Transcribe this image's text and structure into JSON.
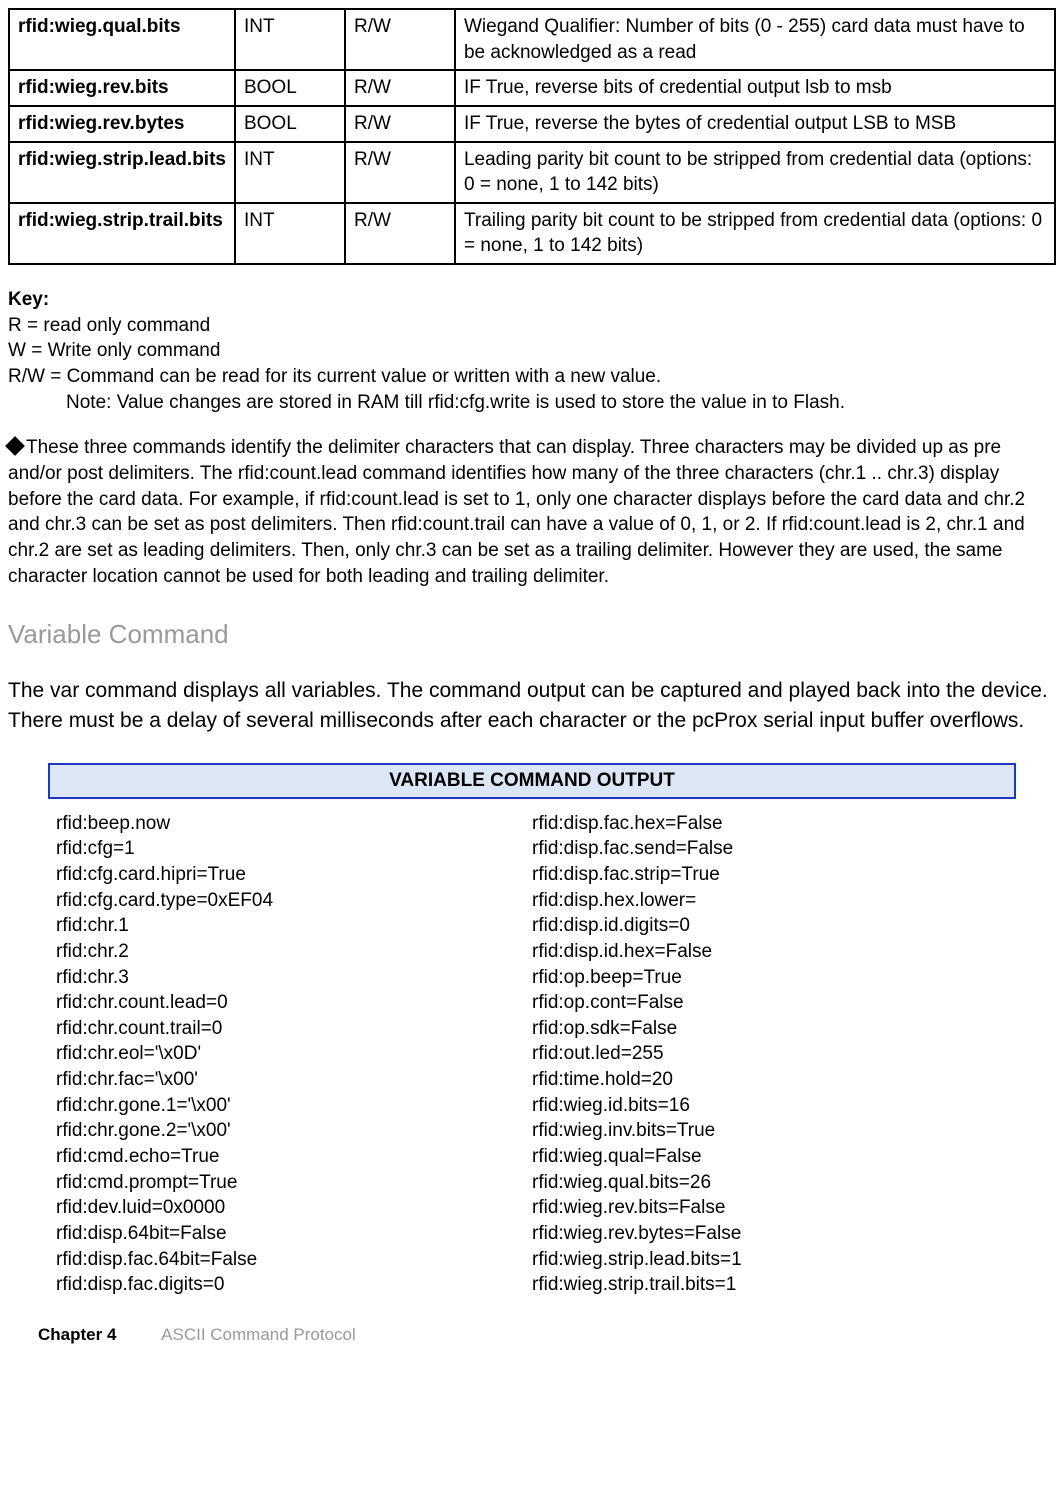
{
  "table": {
    "rows": [
      {
        "name": "rfid:wieg.qual.bits",
        "type": "INT",
        "access": "R/W",
        "desc": "Wiegand Qualifier: Number of bits (0 - 255) card data must have to be acknowledged as a read"
      },
      {
        "name": "rfid:wieg.rev.bits",
        "type": "BOOL",
        "access": "R/W",
        "desc": "IF True, reverse bits of credential output lsb to msb"
      },
      {
        "name": "rfid:wieg.rev.bytes",
        "type": "BOOL",
        "access": "R/W",
        "desc": "IF True, reverse the bytes of credential output LSB to MSB"
      },
      {
        "name": "rfid:wieg.strip.lead.bits",
        "type": "INT",
        "access": "R/W",
        "desc": "Leading parity bit count to be stripped from credential data (options: 0 = none, 1 to 142 bits)"
      },
      {
        "name": "rfid:wieg.strip.trail.bits",
        "type": "INT",
        "access": "R/W",
        "desc": "Trailing parity bit count to be stripped from credential data (options: 0 = none, 1 to 142 bits)"
      }
    ]
  },
  "key": {
    "heading": "Key:",
    "lines": [
      "R = read only command",
      "W = Write only command",
      "R/W = Command can be read for its current value or written with a new value."
    ],
    "note": "Note: Value changes are stored in RAM till rfid:cfg.write is used to store the value in to Flash."
  },
  "delim_para": "These three commands identify the delimiter characters that can display. Three characters may be divided up as pre and/or post delimiters. The rfid:count.lead command identifies how many of the three characters (chr.1 .. chr.3) display before the card data. For example, if rfid:count.lead is set to 1, only one character displays before the card data and chr.2 and chr.3 can be set as post delimiters. Then rfid:count.trail can have a value of 0, 1, or 2. If rfid:count.lead is 2, chr.1 and chr.2 are set as leading delimiters. Then, only chr.3 can be set as a trailing delimiter. However they are used, the same character location cannot be used for both leading and trailing delimiter.",
  "section": {
    "heading": "Variable Command",
    "intro": "The var command displays all variables. The command output can be captured and played back into the device. There must be a delay of several milliseconds after each character or the pcProx serial input buffer overflows."
  },
  "output": {
    "header": "VARIABLE COMMAND OUTPUT",
    "col1": [
      "rfid:beep.now",
      "rfid:cfg=1",
      "rfid:cfg.card.hipri=True",
      "rfid:cfg.card.type=0xEF04",
      "rfid:chr.1",
      "rfid:chr.2",
      "rfid:chr.3",
      "rfid:chr.count.lead=0",
      "rfid:chr.count.trail=0",
      "rfid:chr.eol='\\x0D'",
      "rfid:chr.fac='\\x00'",
      "rfid:chr.gone.1='\\x00'",
      "rfid:chr.gone.2='\\x00'",
      "rfid:cmd.echo=True",
      "rfid:cmd.prompt=True",
      "rfid:dev.luid=0x0000",
      "rfid:disp.64bit=False",
      "rfid:disp.fac.64bit=False",
      "rfid:disp.fac.digits=0"
    ],
    "col2": [
      "rfid:disp.fac.hex=False",
      "rfid:disp.fac.send=False",
      "rfid:disp.fac.strip=True",
      "rfid:disp.hex.lower=",
      "rfid:disp.id.digits=0",
      "rfid:disp.id.hex=False",
      "rfid:op.beep=True",
      "rfid:op.cont=False",
      "rfid:op.sdk=False",
      "rfid:out.led=255",
      "rfid:time.hold=20",
      "rfid:wieg.id.bits=16",
      "rfid:wieg.inv.bits=True",
      "rfid:wieg.qual=False",
      "rfid:wieg.qual.bits=26",
      "rfid:wieg.rev.bits=False",
      "rfid:wieg.rev.bytes=False",
      "rfid:wieg.strip.lead.bits=1",
      "rfid:wieg.strip.trail.bits=1"
    ]
  },
  "footer": {
    "chapter": "Chapter 4",
    "title": "ASCII Command Protocol"
  }
}
